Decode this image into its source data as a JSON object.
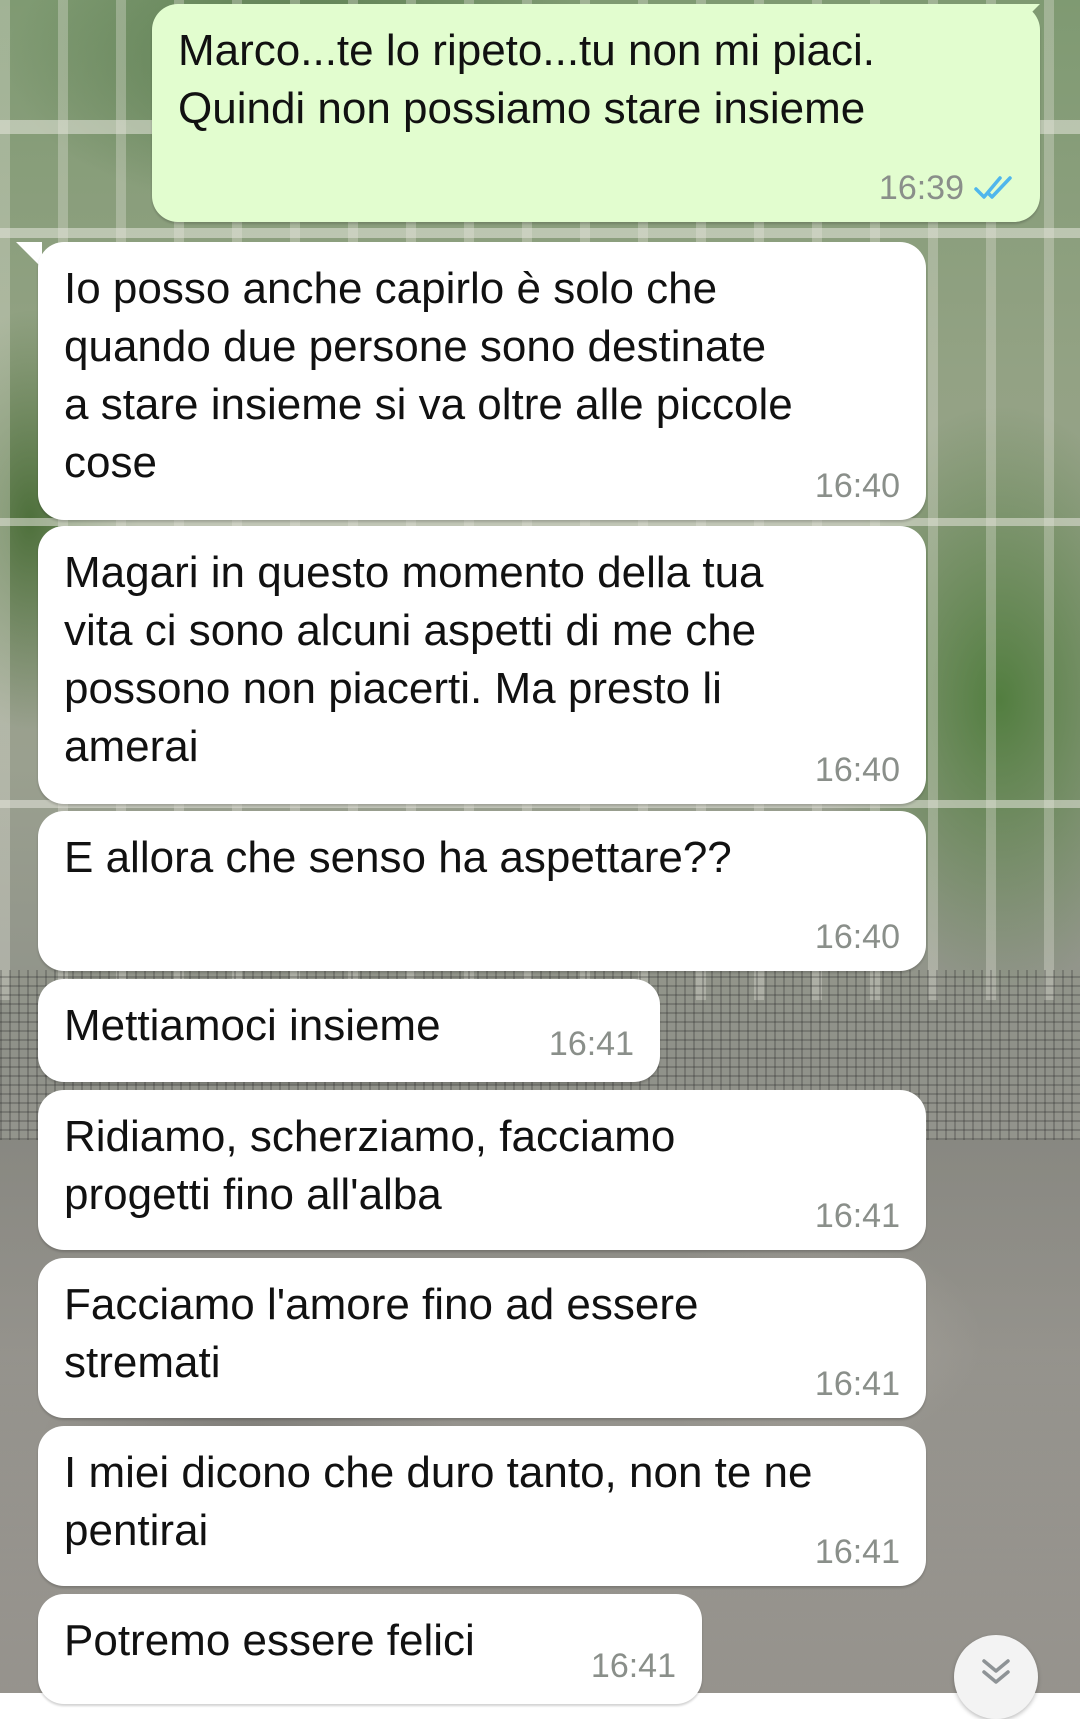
{
  "messages": [
    {
      "direction": "outgoing",
      "text": "Marco...te lo ripeto...tu non mi piaci.\nQuindi non possiamo stare insieme",
      "time": "16:39",
      "status": "read"
    },
    {
      "direction": "incoming",
      "text": "Io posso anche capirlo è solo che\nquando due persone sono destinate\na stare insieme si va oltre alle piccole\ncose",
      "time": "16:40"
    },
    {
      "direction": "incoming",
      "text": "Magari in questo momento della tua\nvita ci sono alcuni aspetti di me che\npossono non piacerti. Ma presto li\namerai",
      "time": "16:40"
    },
    {
      "direction": "incoming",
      "text": "E allora che senso ha aspettare??",
      "time": "16:40"
    },
    {
      "direction": "incoming",
      "text": "Mettiamoci insieme",
      "time": "16:41"
    },
    {
      "direction": "incoming",
      "text": "Ridiamo, scherziamo, facciamo\nprogetti fino all'alba",
      "time": "16:41"
    },
    {
      "direction": "incoming",
      "text": "Facciamo l'amore fino ad essere\nstremati",
      "time": "16:41"
    },
    {
      "direction": "incoming",
      "text": "I miei dicono che duro tanto, non te ne\npentirai",
      "time": "16:41"
    },
    {
      "direction": "incoming",
      "text": "Potremo essere felici",
      "time": "16:41"
    }
  ],
  "icons": {
    "read_receipt": "double-check-icon",
    "scroll_down": "double-chevron-down-icon"
  },
  "colors": {
    "outgoing_bubble": "#e2fdcf",
    "incoming_bubble": "#ffffff",
    "read_tick": "#4fb6ec",
    "timestamp": "#8a8f8a"
  }
}
